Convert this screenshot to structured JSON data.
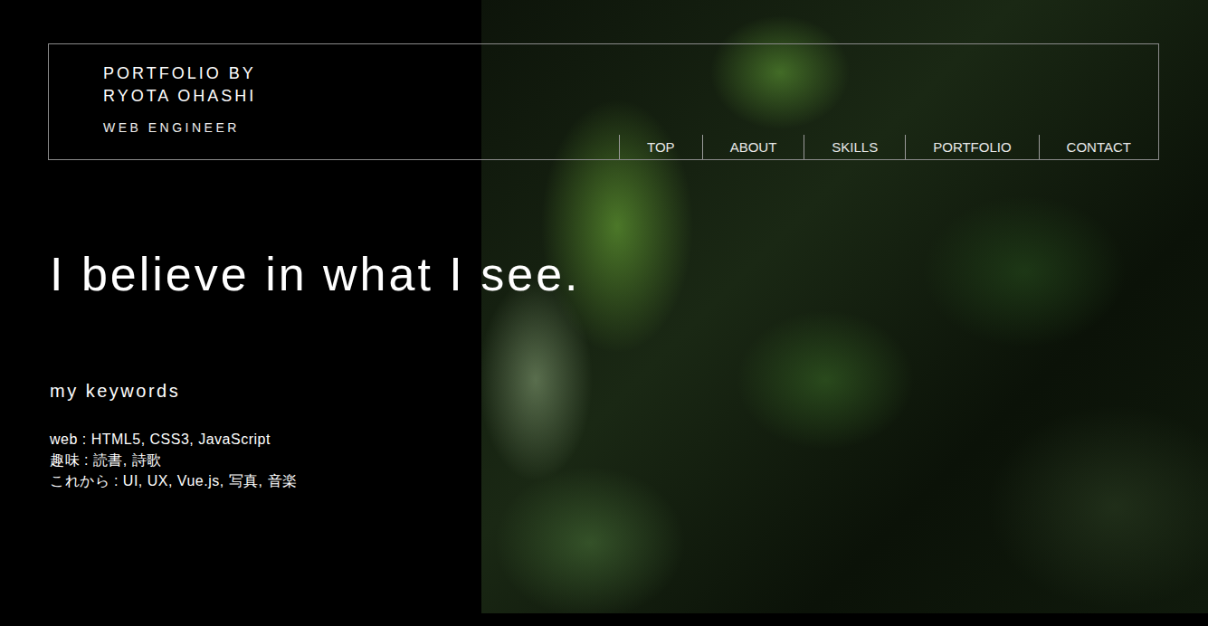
{
  "header": {
    "title_lines": [
      "PORTFOLIO BY",
      "RYOTA OHASHI"
    ],
    "subtitle": "WEB ENGINEER"
  },
  "nav": [
    {
      "label": "TOP"
    },
    {
      "label": "ABOUT"
    },
    {
      "label": "SKILLS"
    },
    {
      "label": "PORTFOLIO"
    },
    {
      "label": "CONTACT"
    }
  ],
  "headline": "I believe in what I see.",
  "keywords": {
    "heading": "my keywords",
    "lines": [
      "web : HTML5, CSS3, JavaScript",
      "趣味 : 読書, 詩歌",
      "これから : UI, UX, Vue.js, 写真, 音楽"
    ]
  }
}
